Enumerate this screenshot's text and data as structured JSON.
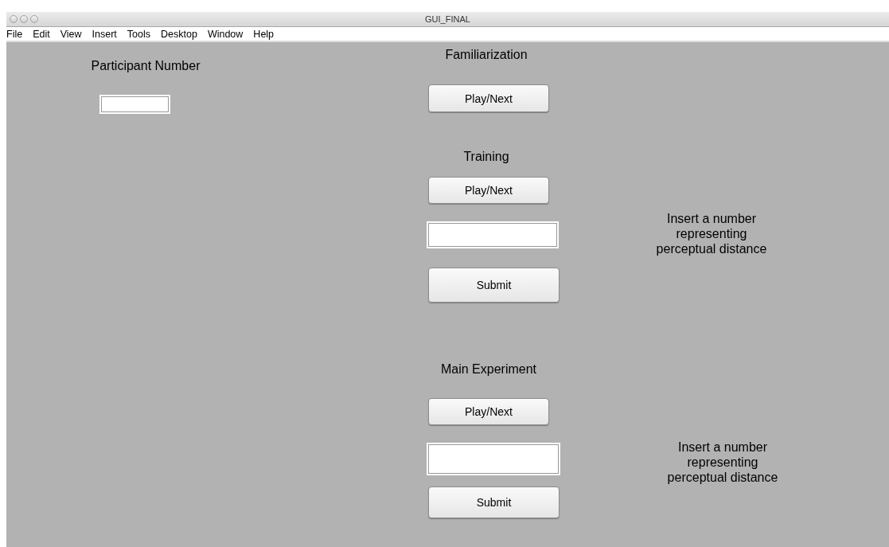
{
  "window": {
    "title": "GUI_FINAL"
  },
  "menu": [
    "File",
    "Edit",
    "View",
    "Insert",
    "Tools",
    "Desktop",
    "Window",
    "Help"
  ],
  "controls": [
    {
      "kind": "label",
      "text": "Participant Number"
    },
    {
      "kind": "field"
    },
    {
      "kind": "label",
      "text": "Familiarization"
    },
    {
      "kind": "button",
      "text": "Play/Next"
    },
    {
      "kind": "label",
      "text": "Training"
    },
    {
      "kind": "button",
      "text": "Play/Next"
    },
    {
      "kind": "field"
    },
    {
      "kind": "label",
      "text": "Insert a number representing perceptual distance"
    },
    {
      "kind": "button",
      "text": "Submit"
    },
    {
      "kind": "label",
      "text": "Main Experiment"
    },
    {
      "kind": "button",
      "text": "Play/Next"
    },
    {
      "kind": "field"
    },
    {
      "kind": "label",
      "text": "Insert a number representing perceptual distance"
    },
    {
      "kind": "button",
      "text": "Submit"
    }
  ]
}
